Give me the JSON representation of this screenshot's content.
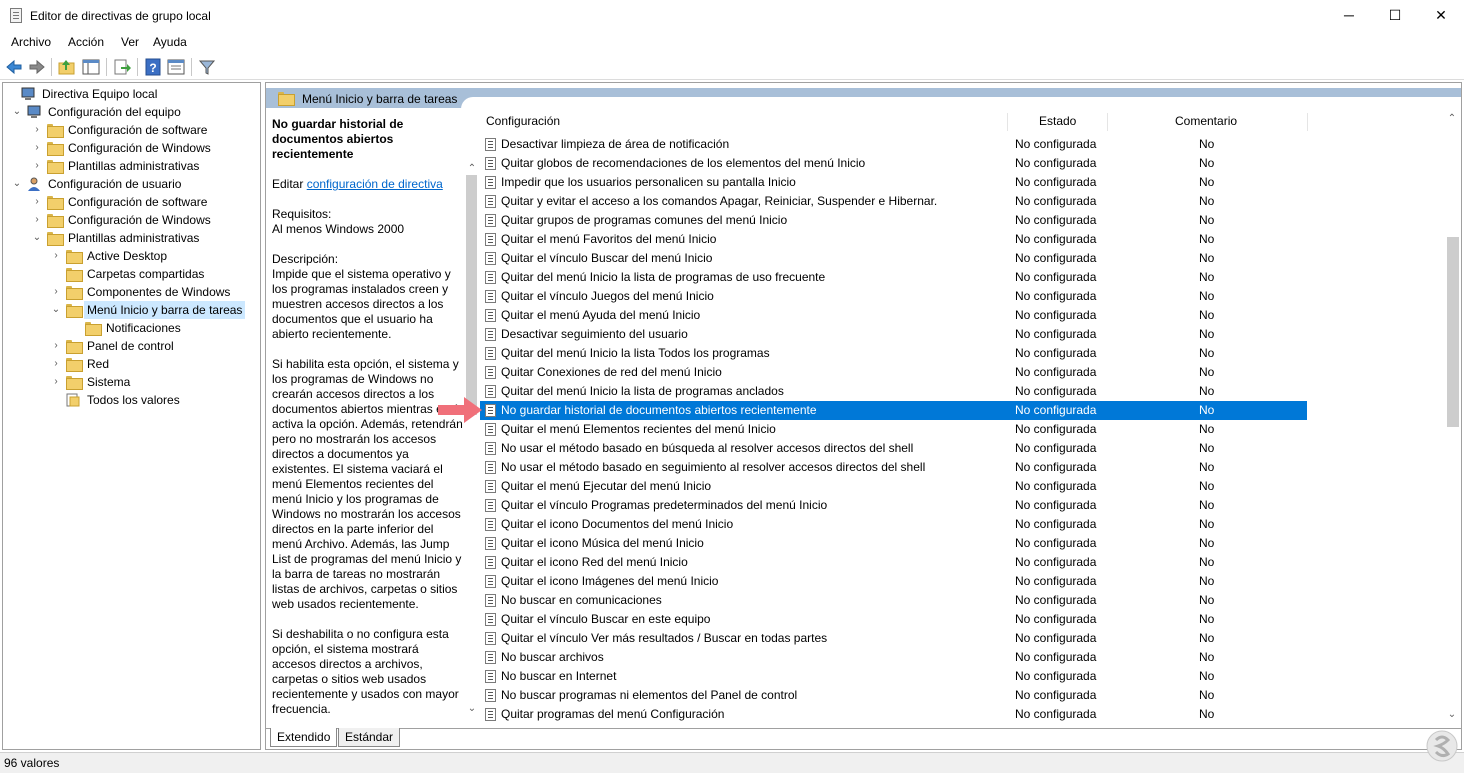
{
  "window": {
    "title": "Editor de directivas de grupo local",
    "minimize": "─",
    "maximize": "☐",
    "close": "✕"
  },
  "menu": [
    "Archivo",
    "Acción",
    "Ver",
    "Ayuda"
  ],
  "toolbar": [
    "back-icon",
    "forward-icon",
    "up-folder-icon",
    "show-hide-tree-icon",
    "export-icon",
    "help-icon",
    "properties-icon",
    "filter-icon"
  ],
  "tree": [
    {
      "label": "Directiva Equipo local"
    },
    {
      "label": "Configuración del equipo"
    },
    {
      "label": "Configuración de software"
    },
    {
      "label": "Configuración de Windows"
    },
    {
      "label": "Plantillas administrativas"
    },
    {
      "label": "Configuración de usuario"
    },
    {
      "label": "Configuración de software"
    },
    {
      "label": "Configuración de Windows"
    },
    {
      "label": "Plantillas administrativas"
    },
    {
      "label": "Active Desktop"
    },
    {
      "label": "Carpetas compartidas"
    },
    {
      "label": "Componentes de Windows"
    },
    {
      "label": "Menú Inicio y barra de tareas"
    },
    {
      "label": "Notificaciones"
    },
    {
      "label": "Panel de control"
    },
    {
      "label": "Red"
    },
    {
      "label": "Sistema"
    },
    {
      "label": "Todos los valores"
    }
  ],
  "right_header": "Menú Inicio y barra de tareas",
  "description": {
    "title": "No guardar historial de documentos abiertos recientemente",
    "edit_prefix": "Editar",
    "edit_link": "configuración de directiva",
    "requirements_label": "Requisitos:",
    "requirements_value": "Al menos Windows 2000",
    "desc_label": "Descripción:",
    "p1": "Impide que el sistema operativo y los programas instalados creen y muestren accesos directos a los documentos que el usuario ha abierto recientemente.",
    "p2": "Si habilita esta opción, el sistema y los programas de Windows no crearán accesos directos a los documentos abiertos mientras esté activa la opción. Además, retendrán pero no mostrarán los accesos directos a documentos ya existentes. El sistema vaciará el menú Elementos recientes del menú Inicio y los programas de Windows no mostrarán los accesos directos en la parte inferior del menú Archivo. Además, las Jump List de programas del menú Inicio y la barra de tareas no mostrarán listas de archivos, carpetas o sitios web usados recientemente.",
    "p3": "Si deshabilita o no configura esta opción, el sistema mostrará accesos directos a archivos, carpetas o sitios web usados recientemente y usados con mayor frecuencia."
  },
  "columns": {
    "setting": "Configuración",
    "state": "Estado",
    "comment": "Comentario"
  },
  "policies": [
    {
      "name": "Desactivar limpieza de área de notificación",
      "state": "No configurada",
      "comment": "No"
    },
    {
      "name": "Quitar globos de recomendaciones de los elementos del menú Inicio",
      "state": "No configurada",
      "comment": "No"
    },
    {
      "name": "Impedir que los usuarios personalicen su pantalla Inicio",
      "state": "No configurada",
      "comment": "No"
    },
    {
      "name": "Quitar y evitar el acceso a los comandos Apagar, Reiniciar, Suspender e Hibernar.",
      "state": "No configurada",
      "comment": "No"
    },
    {
      "name": "Quitar grupos de programas comunes del menú Inicio",
      "state": "No configurada",
      "comment": "No"
    },
    {
      "name": "Quitar el menú Favoritos del menú Inicio",
      "state": "No configurada",
      "comment": "No"
    },
    {
      "name": "Quitar el vínculo Buscar del menú Inicio",
      "state": "No configurada",
      "comment": "No"
    },
    {
      "name": "Quitar del menú Inicio la lista de programas de uso frecuente",
      "state": "No configurada",
      "comment": "No"
    },
    {
      "name": "Quitar el vínculo Juegos del menú Inicio",
      "state": "No configurada",
      "comment": "No"
    },
    {
      "name": "Quitar el menú Ayuda del menú Inicio",
      "state": "No configurada",
      "comment": "No"
    },
    {
      "name": "Desactivar seguimiento del usuario",
      "state": "No configurada",
      "comment": "No"
    },
    {
      "name": "Quitar del menú Inicio la lista Todos los programas",
      "state": "No configurada",
      "comment": "No"
    },
    {
      "name": "Quitar Conexiones de red del menú Inicio",
      "state": "No configurada",
      "comment": "No"
    },
    {
      "name": "Quitar del menú Inicio la lista de programas anclados",
      "state": "No configurada",
      "comment": "No"
    },
    {
      "name": "No guardar historial de documentos abiertos recientemente",
      "state": "No configurada",
      "comment": "No"
    },
    {
      "name": "Quitar el menú Elementos recientes del menú Inicio",
      "state": "No configurada",
      "comment": "No"
    },
    {
      "name": "No usar el método basado en búsqueda al resolver accesos directos del shell",
      "state": "No configurada",
      "comment": "No"
    },
    {
      "name": "No usar el método basado en seguimiento al resolver accesos directos del shell",
      "state": "No configurada",
      "comment": "No"
    },
    {
      "name": "Quitar el menú Ejecutar del menú Inicio",
      "state": "No configurada",
      "comment": "No"
    },
    {
      "name": "Quitar el vínculo Programas predeterminados del menú Inicio",
      "state": "No configurada",
      "comment": "No"
    },
    {
      "name": "Quitar el icono Documentos del menú Inicio",
      "state": "No configurada",
      "comment": "No"
    },
    {
      "name": "Quitar el icono Música del menú Inicio",
      "state": "No configurada",
      "comment": "No"
    },
    {
      "name": "Quitar el icono Red del menú Inicio",
      "state": "No configurada",
      "comment": "No"
    },
    {
      "name": "Quitar el icono Imágenes del menú Inicio",
      "state": "No configurada",
      "comment": "No"
    },
    {
      "name": "No buscar en comunicaciones",
      "state": "No configurada",
      "comment": "No"
    },
    {
      "name": "Quitar el vínculo Buscar en este equipo",
      "state": "No configurada",
      "comment": "No"
    },
    {
      "name": "Quitar el vínculo Ver más resultados / Buscar en todas partes",
      "state": "No configurada",
      "comment": "No"
    },
    {
      "name": "No buscar archivos",
      "state": "No configurada",
      "comment": "No"
    },
    {
      "name": "No buscar en Internet",
      "state": "No configurada",
      "comment": "No"
    },
    {
      "name": "No buscar programas ni elementos del Panel de control",
      "state": "No configurada",
      "comment": "No"
    },
    {
      "name": "Quitar programas del menú Configuración",
      "state": "No configurada",
      "comment": "No"
    }
  ],
  "selected_index": 14,
  "tabs": [
    "Extendido",
    "Estándar"
  ],
  "status": "96 valores",
  "colors": {
    "selection": "#0078d7",
    "header_band": "#a8bfd8",
    "arrow": "#f0707a"
  }
}
